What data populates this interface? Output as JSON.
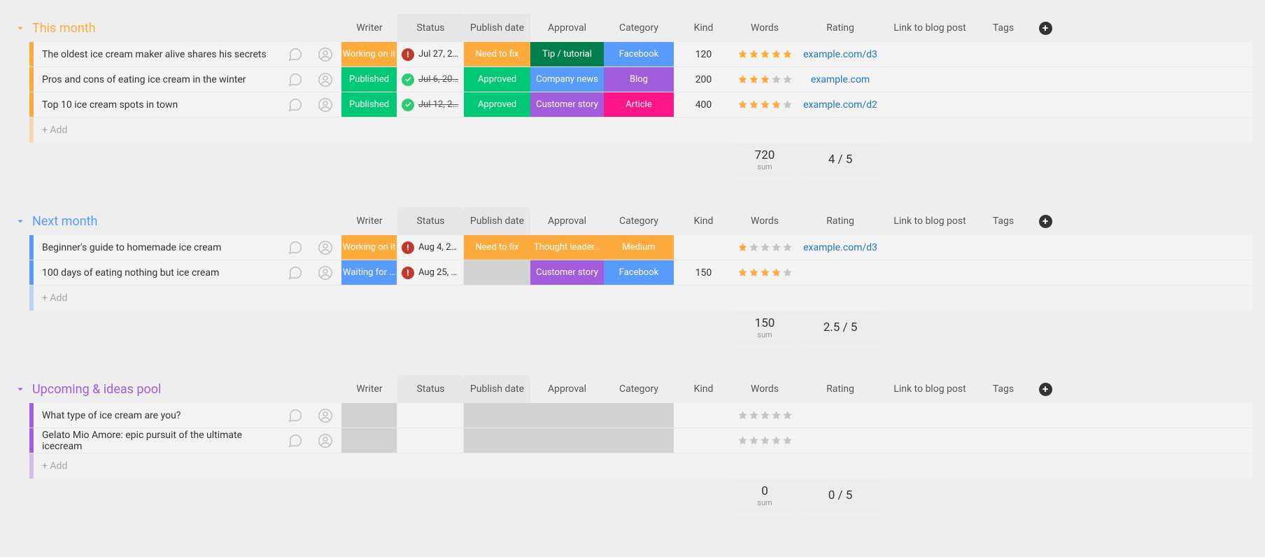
{
  "columns": {
    "writer": "Writer",
    "status": "Status",
    "publish_date": "Publish date",
    "approval": "Approval",
    "category": "Category",
    "kind": "Kind",
    "words": "Words",
    "rating": "Rating",
    "link": "Link to blog post",
    "tags": "Tags"
  },
  "add_label": "+ Add",
  "sum_label": "sum",
  "colors": {
    "this_month": "#fdab3d",
    "next_month": "#579bfc",
    "upcoming": "#a25ddc",
    "status_working": "#fdab3d",
    "status_published": "#00c875",
    "status_waiting": "#579bfc",
    "approval_needfix": "#fdab3d",
    "approval_approved": "#00c875",
    "cat_tip": "#037f4c",
    "cat_company": "#579bfc",
    "cat_customer": "#a25ddc",
    "cat_thought": "#fdab3d",
    "kind_facebook": "#579bfc",
    "kind_blog": "#a25ddc",
    "kind_article": "#e2445c",
    "kind_medium": "#fdab3d",
    "kind_article_pink": "#ff158a",
    "star_on": "#fdab3d",
    "star_off": "#c4c4c4"
  },
  "groups": [
    {
      "id": "this_month",
      "title": "This month",
      "accent": "#fdab3d",
      "rows": [
        {
          "title": "The oldest ice cream maker alive shares his secrets",
          "status": {
            "label": "Working on it",
            "color": "#fdab3d"
          },
          "date": {
            "text": "Jul 27, 2…",
            "state": "overdue",
            "strike": false
          },
          "approval": {
            "label": "Need to fix",
            "color": "#fdab3d"
          },
          "category": {
            "label": "Tip / tutorial",
            "color": "#037f4c"
          },
          "kind": {
            "label": "Facebook",
            "color": "#579bfc"
          },
          "words": "120",
          "rating": 5,
          "link": "example.com/d3"
        },
        {
          "title": "Pros and cons of eating ice cream in the winter",
          "status": {
            "label": "Published",
            "color": "#00c875"
          },
          "date": {
            "text": "Jul 6, 20…",
            "state": "done",
            "strike": true
          },
          "approval": {
            "label": "Approved",
            "color": "#00c875"
          },
          "category": {
            "label": "Company news",
            "color": "#579bfc"
          },
          "kind": {
            "label": "Blog",
            "color": "#a25ddc"
          },
          "words": "200",
          "rating": 3,
          "link": "example.com"
        },
        {
          "title": "Top 10 ice cream spots in town",
          "status": {
            "label": "Published",
            "color": "#00c875"
          },
          "date": {
            "text": "Jul 12, 2…",
            "state": "done",
            "strike": true
          },
          "approval": {
            "label": "Approved",
            "color": "#00c875"
          },
          "category": {
            "label": "Customer story",
            "color": "#a25ddc"
          },
          "kind": {
            "label": "Article",
            "color": "#ff158a"
          },
          "words": "400",
          "rating": 4,
          "link": "example.com/d2"
        }
      ],
      "summary": {
        "words": "720",
        "rating": "4 / 5"
      }
    },
    {
      "id": "next_month",
      "title": "Next month",
      "accent": "#579bfc",
      "rows": [
        {
          "title": "Beginner's guide to homemade ice cream",
          "status": {
            "label": "Working on it",
            "color": "#fdab3d"
          },
          "date": {
            "text": "Aug 4, 2…",
            "state": "overdue",
            "strike": false
          },
          "approval": {
            "label": "Need to fix",
            "color": "#fdab3d"
          },
          "category": {
            "label": "Thought leader…",
            "color": "#fdab3d"
          },
          "kind": {
            "label": "Medium",
            "color": "#fdab3d"
          },
          "words": "",
          "rating": 1,
          "link": "example.com/d3"
        },
        {
          "title": "100 days of eating nothing but ice cream",
          "status": {
            "label": "Waiting for …",
            "color": "#579bfc"
          },
          "date": {
            "text": "Aug 25, …",
            "state": "overdue",
            "strike": false
          },
          "approval": {
            "label": "",
            "color": ""
          },
          "category": {
            "label": "Customer story",
            "color": "#a25ddc"
          },
          "kind": {
            "label": "Facebook",
            "color": "#579bfc"
          },
          "words": "150",
          "rating": 4,
          "link": ""
        }
      ],
      "summary": {
        "words": "150",
        "rating": "2.5 / 5"
      }
    },
    {
      "id": "upcoming",
      "title": "Upcoming & ideas pool",
      "accent": "#a25ddc",
      "rows": [
        {
          "title": "What type of ice cream are you?",
          "status": {
            "label": "",
            "color": ""
          },
          "date": {
            "text": "",
            "state": "",
            "strike": false
          },
          "approval": {
            "label": "",
            "color": ""
          },
          "category": {
            "label": "",
            "color": ""
          },
          "kind": {
            "label": "",
            "color": ""
          },
          "words": "",
          "rating": 0,
          "link": ""
        },
        {
          "title": "Gelato Mio Amore: epic pursuit of the ultimate icecream",
          "status": {
            "label": "",
            "color": ""
          },
          "date": {
            "text": "",
            "state": "",
            "strike": false
          },
          "approval": {
            "label": "",
            "color": ""
          },
          "category": {
            "label": "",
            "color": ""
          },
          "kind": {
            "label": "",
            "color": ""
          },
          "words": "",
          "rating": 0,
          "link": ""
        }
      ],
      "summary": {
        "words": "0",
        "rating": "0 / 5"
      }
    }
  ]
}
